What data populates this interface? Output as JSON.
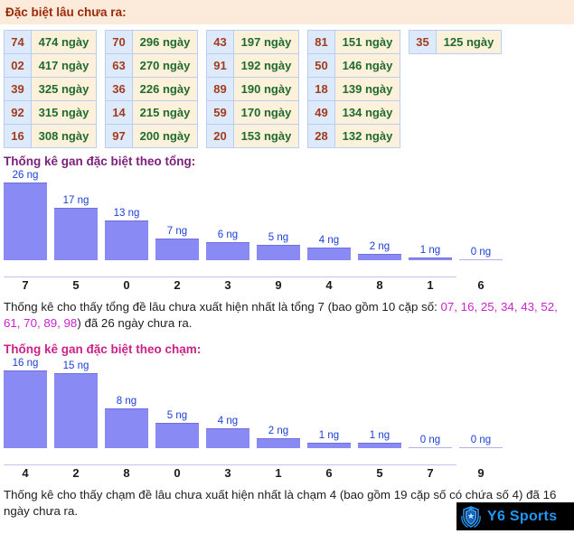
{
  "header": {
    "title": "Đặc biệt lâu chưa ra:"
  },
  "gan_tables": [
    {
      "rows": [
        {
          "num": "74",
          "days": "474 ngày"
        },
        {
          "num": "02",
          "days": "417 ngày"
        },
        {
          "num": "39",
          "days": "325 ngày"
        },
        {
          "num": "92",
          "days": "315 ngày"
        },
        {
          "num": "16",
          "days": "308 ngày"
        }
      ]
    },
    {
      "rows": [
        {
          "num": "70",
          "days": "296 ngày"
        },
        {
          "num": "63",
          "days": "270 ngày"
        },
        {
          "num": "36",
          "days": "226 ngày"
        },
        {
          "num": "14",
          "days": "215 ngày"
        },
        {
          "num": "97",
          "days": "200 ngày"
        }
      ]
    },
    {
      "rows": [
        {
          "num": "43",
          "days": "197 ngày"
        },
        {
          "num": "91",
          "days": "192 ngày"
        },
        {
          "num": "89",
          "days": "190 ngày"
        },
        {
          "num": "59",
          "days": "170 ngày"
        },
        {
          "num": "20",
          "days": "153 ngày"
        }
      ]
    },
    {
      "rows": [
        {
          "num": "81",
          "days": "151 ngày"
        },
        {
          "num": "50",
          "days": "146 ngày"
        },
        {
          "num": "18",
          "days": "139 ngày"
        },
        {
          "num": "49",
          "days": "134 ngày"
        },
        {
          "num": "28",
          "days": "132 ngày"
        }
      ]
    },
    {
      "rows": [
        {
          "num": "35",
          "days": "125 ngày"
        }
      ]
    }
  ],
  "chart_data": [
    {
      "type": "bar",
      "title": "Thống kê gan đặc biệt theo tổng:",
      "title_color": "#7b1f7b",
      "bar_color": "#8a8af4",
      "label_color": "#1a3fd6",
      "xlabel": "",
      "ylabel": "ngày",
      "ylim": [
        0,
        26
      ],
      "grid": false,
      "legend": "none",
      "categories": [
        "7",
        "5",
        "0",
        "2",
        "3",
        "9",
        "4",
        "8",
        "1",
        "6"
      ],
      "values": [
        26,
        17,
        13,
        7,
        6,
        5,
        4,
        2,
        1,
        0
      ],
      "value_labels": [
        "26 ng",
        "17 ng",
        "13 ng",
        "7 ng",
        "6 ng",
        "5 ng",
        "4 ng",
        "2 ng",
        "1 ng",
        "0 ng"
      ]
    },
    {
      "type": "bar",
      "title": "Thống kê gan đặc biệt theo chạm:",
      "title_color": "#cc2288",
      "bar_color": "#8a8af4",
      "label_color": "#1a3fd6",
      "xlabel": "",
      "ylabel": "ngày",
      "ylim": [
        0,
        16
      ],
      "grid": false,
      "legend": "none",
      "categories": [
        "4",
        "2",
        "8",
        "0",
        "3",
        "1",
        "6",
        "5",
        "7",
        "9"
      ],
      "values": [
        16,
        15,
        8,
        5,
        4,
        2,
        1,
        1,
        0,
        0
      ],
      "value_labels": [
        "16 ng",
        "15 ng",
        "8 ng",
        "5 ng",
        "4 ng",
        "2 ng",
        "1 ng",
        "1 ng",
        "0 ng",
        "0 ng"
      ]
    }
  ],
  "paragraphs": {
    "tong": {
      "part1": "Thống kê cho thấy tổng đề lâu chưa xuất hiện nhất là tổng 7 (bao gồm 10 cặp số: ",
      "pairs": "07, 16, 25, 34, 43, 52, 61, 70, 89, 98",
      "part2": ") đã 26 ngày chưa ra."
    },
    "cham": {
      "text": "Thống kê cho thấy chạm đề lâu chưa xuất hiện nhất là chạm 4 (bao gồm 19 cặp số có chứa số 4) đã 16 ngày chưa ra."
    }
  },
  "watermark": {
    "text": "Y6 Sports",
    "text_color": "#2196f3",
    "bg_color": "#000000"
  }
}
